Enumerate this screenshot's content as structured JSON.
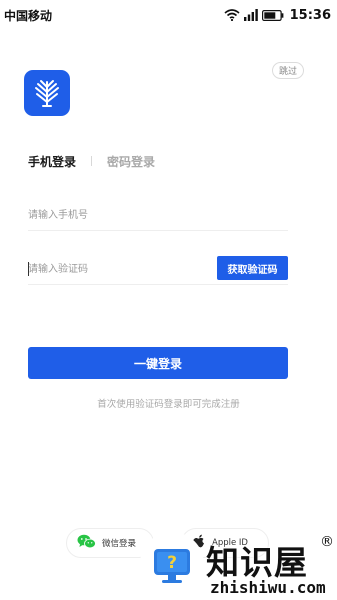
{
  "status_bar": {
    "carrier": "中国移动",
    "time": "15:36",
    "icons": [
      "wifi-icon",
      "signal-icon",
      "battery-icon"
    ]
  },
  "header": {
    "skip_label": "跳过",
    "logo_icon": "app-logo-icon"
  },
  "tabs": [
    {
      "label": "手机登录",
      "active": true
    },
    {
      "label": "密码登录",
      "active": false
    }
  ],
  "form": {
    "phone_placeholder": "请输入手机号",
    "code_placeholder": "请输入验证码",
    "get_code_label": "获取验证码",
    "login_label": "一键登录",
    "hint": "首次使用验证码登录即可完成注册"
  },
  "social": {
    "wechat_label": "微信登录",
    "apple_label": "Apple ID"
  },
  "watermark": {
    "title": "知识屋",
    "reg_mark": "®",
    "subtitle": "zhishiwu.com"
  },
  "colors": {
    "primary": "#1f5ee8",
    "wechat": "#28c445"
  }
}
